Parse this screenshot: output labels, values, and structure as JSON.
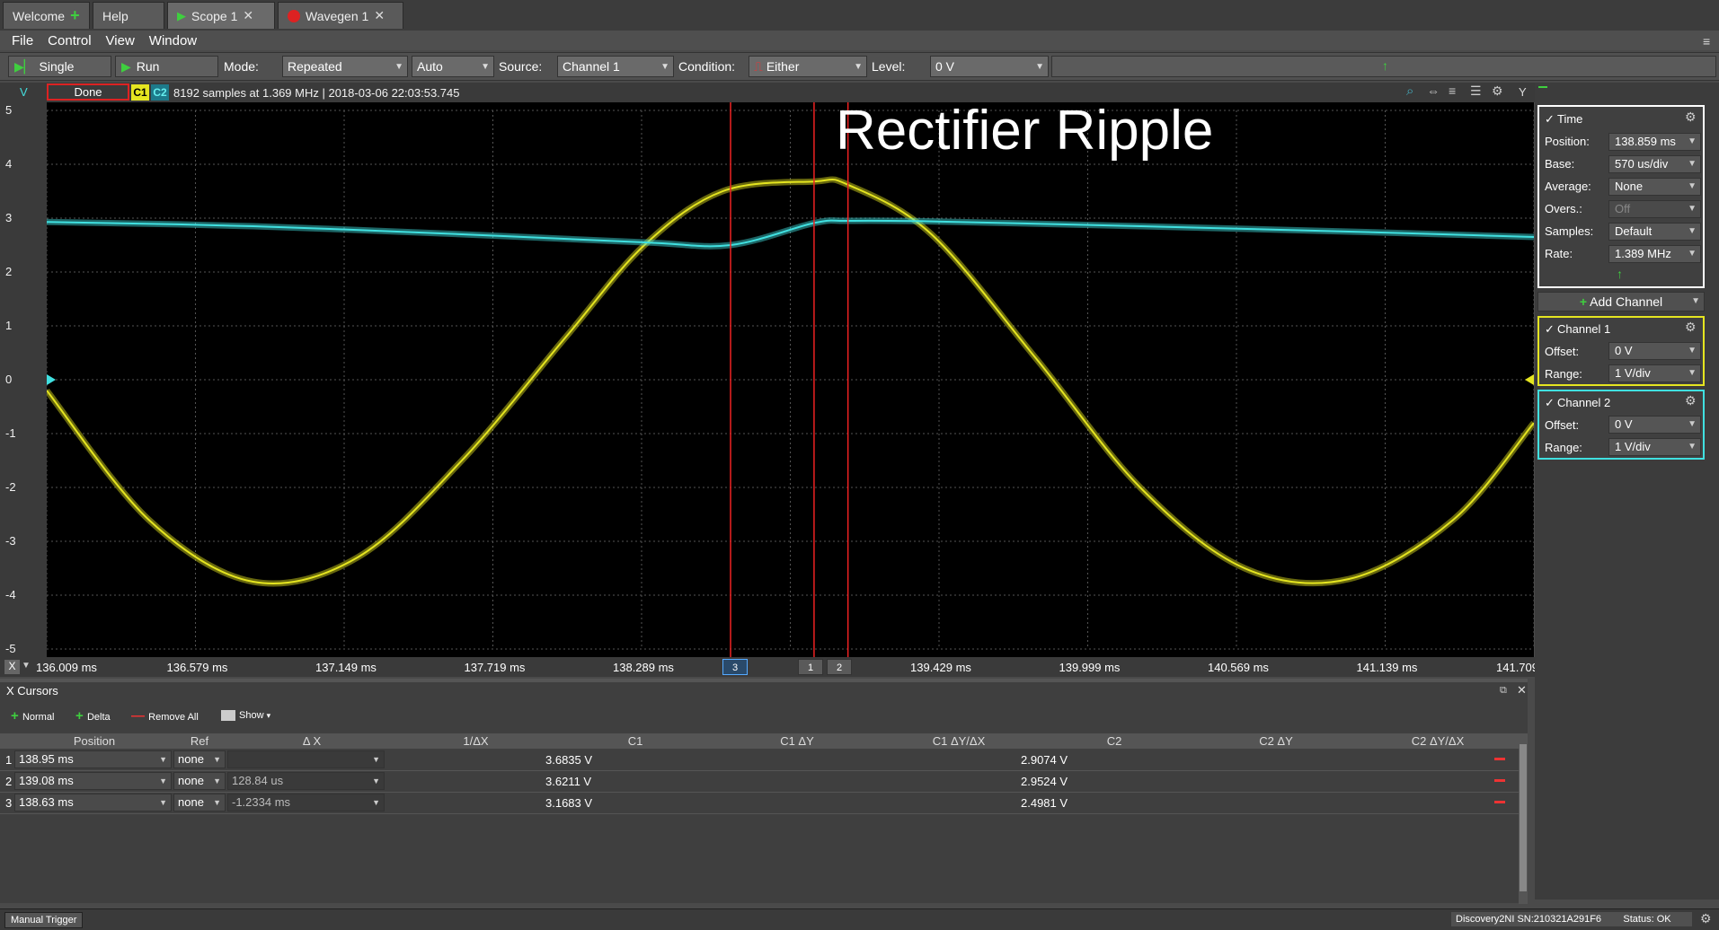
{
  "tabs": [
    {
      "label": "Welcome"
    },
    {
      "label": "Help"
    },
    {
      "label": "Scope 1"
    },
    {
      "label": "Wavegen 1"
    }
  ],
  "menu": [
    "File",
    "Control",
    "View",
    "Window"
  ],
  "toolbar": {
    "single_label": "Single",
    "run_label": "Run",
    "mode_label": "Mode:",
    "mode_value": "Repeated",
    "auto_value": "Auto",
    "source_label": "Source:",
    "source_value": "Channel 1",
    "condition_label": "Condition:",
    "condition_value": "Either",
    "level_label": "Level:",
    "level_value": "0 V"
  },
  "plot": {
    "y_axis_title": "V",
    "status": "Done",
    "c1_badge": "C1",
    "c2_badge": "C2",
    "info": "8192 samples at 1.369 MHz | 2018-03-06 22:03:53.745",
    "title": "Rectifier Ripple",
    "y_ticks": [
      "5",
      "4",
      "3",
      "2",
      "1",
      "0",
      "-1",
      "-2",
      "-3",
      "-4",
      "-5"
    ],
    "x_ticks": [
      "136.009 ms",
      "136.579 ms",
      "137.149 ms",
      "137.719 ms",
      "138.289 ms",
      "138",
      "139.429 ms",
      "139.999 ms",
      "140.569 ms",
      "141.139 ms",
      "141.709"
    ],
    "cursor_tags": [
      "3",
      "1",
      "2"
    ],
    "y_side_label": "Y"
  },
  "chart_data": {
    "type": "line",
    "xlabel": "",
    "ylabel": "V",
    "xlim": [
      136.009,
      141.709
    ],
    "ylim": [
      -5,
      5
    ],
    "grid": true,
    "series": [
      {
        "name": "C1",
        "color": "#e5e520",
        "x": [
          136.009,
          136.4,
          136.8,
          137.2,
          137.6,
          138.0,
          138.3,
          138.6,
          138.95,
          139.08,
          139.4,
          139.8,
          140.2,
          140.6,
          141.0,
          141.4,
          141.709
        ],
        "y": [
          -0.2,
          -2.6,
          -3.75,
          -3.3,
          -1.5,
          0.8,
          2.5,
          3.5,
          3.68,
          3.62,
          2.7,
          0.4,
          -2.0,
          -3.5,
          -3.7,
          -2.6,
          -0.8
        ]
      },
      {
        "name": "C2",
        "color": "#40e0e0",
        "x": [
          136.009,
          136.8,
          137.6,
          138.3,
          138.63,
          138.95,
          139.08,
          139.4,
          140.2,
          141.0,
          141.709
        ],
        "y": [
          2.93,
          2.85,
          2.7,
          2.55,
          2.5,
          2.91,
          2.95,
          2.94,
          2.85,
          2.75,
          2.65
        ]
      }
    ],
    "cursors_ms": [
      138.95,
      139.08,
      138.63
    ]
  },
  "time_panel": {
    "title": "Time",
    "rows": [
      {
        "label": "Position:",
        "value": "138.859 ms"
      },
      {
        "label": "Base:",
        "value": "570 us/div"
      },
      {
        "label": "Average:",
        "value": "None"
      },
      {
        "label": "Overs.:",
        "value": "Off"
      },
      {
        "label": "Samples:",
        "value": "Default"
      },
      {
        "label": "Rate:",
        "value": "1.389 MHz"
      }
    ]
  },
  "add_channel_label": "Add Channel",
  "channel1": {
    "title": "Channel 1",
    "offset_label": "Offset:",
    "offset": "0 V",
    "range_label": "Range:",
    "range": "1 V/div",
    "color": "#e5e520"
  },
  "channel2": {
    "title": "Channel 2",
    "offset_label": "Offset:",
    "offset": "0 V",
    "range_label": "Range:",
    "range": "1 V/div",
    "color": "#40e0e0"
  },
  "cursors": {
    "title": "X Cursors",
    "normal_label": "Normal",
    "delta_label": "Delta",
    "remove_all_label": "Remove All",
    "show_label": "Show",
    "headers": [
      "Position",
      "Ref",
      "Δ X",
      "1/ΔX",
      "C1",
      "C1 ΔY",
      "C1 ΔY/ΔX",
      "C2",
      "C2 ΔY",
      "C2 ΔY/ΔX"
    ],
    "rows": [
      {
        "n": "1",
        "position": "138.95 ms",
        "ref": "none",
        "dx": "",
        "c1": "3.6835 V",
        "c2": "2.9074 V"
      },
      {
        "n": "2",
        "position": "139.08 ms",
        "ref": "none",
        "dx": "128.84 us",
        "c1": "3.6211 V",
        "c2": "2.9524 V"
      },
      {
        "n": "3",
        "position": "138.63 ms",
        "ref": "none",
        "dx": "-1.2334 ms",
        "c1": "3.1683 V",
        "c2": "2.4981 V"
      }
    ]
  },
  "status": {
    "manual_trigger": "Manual Trigger",
    "device": "Discovery2NI SN:210321A291F6",
    "status": "Status: OK"
  }
}
